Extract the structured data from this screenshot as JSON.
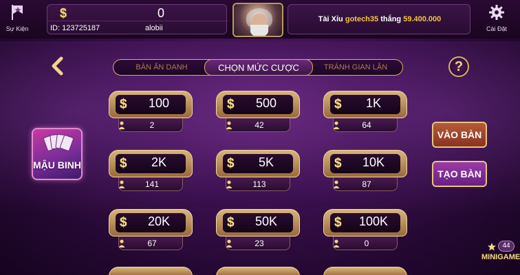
{
  "top": {
    "events_label": "Sự Kiện",
    "settings_label": "Cài Đặt",
    "user": {
      "balance": "0",
      "id_text": "ID: 123725187",
      "username": "alobii"
    },
    "news": {
      "game": "Tài Xỉu",
      "user": "gotech35",
      "word": "thắng",
      "amount": "59.400.000"
    }
  },
  "tabs": [
    {
      "label": "BÀN ẨN DANH"
    },
    {
      "label": "CHỌN MỨC CƯỢC"
    },
    {
      "label": "TRÁNH GIAN LẬN"
    }
  ],
  "help_label": "?",
  "game": {
    "name": "MẬU BINH"
  },
  "actions": {
    "join_label": "VÀO BÀN",
    "create_label": "TẠO BÀN"
  },
  "currency_symbol": "$",
  "bets": [
    {
      "amount": "100",
      "players": "2"
    },
    {
      "amount": "500",
      "players": "42"
    },
    {
      "amount": "1K",
      "players": "64"
    },
    {
      "amount": "2K",
      "players": "141"
    },
    {
      "amount": "5K",
      "players": "113"
    },
    {
      "amount": "10K",
      "players": "87"
    },
    {
      "amount": "20K",
      "players": "67"
    },
    {
      "amount": "50K",
      "players": "23"
    },
    {
      "amount": "100K",
      "players": "0"
    }
  ],
  "minigame": {
    "label": "MINIGAME",
    "count": "44"
  },
  "colors": {
    "gold": "#d8b062",
    "purple_bg": "#3a0f4d",
    "highlight_yellow": "#f4c542"
  }
}
